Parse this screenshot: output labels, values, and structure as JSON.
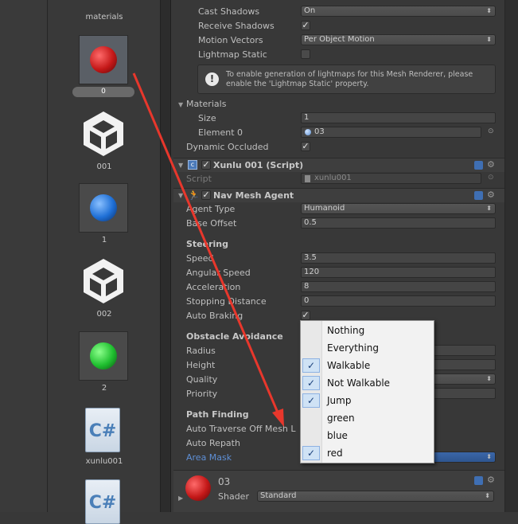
{
  "project_panel": {
    "assets": [
      {
        "name": "materials"
      },
      {
        "name": "0"
      },
      {
        "name": "001"
      },
      {
        "name": "1"
      },
      {
        "name": "002"
      },
      {
        "name": "2"
      },
      {
        "name": "xunlu001"
      }
    ],
    "cs_glyph": "C#"
  },
  "mesh_renderer": {
    "cast_shadows_label": "Cast Shadows",
    "cast_shadows_value": "On",
    "receive_shadows_label": "Receive Shadows",
    "motion_vectors_label": "Motion Vectors",
    "motion_vectors_value": "Per Object Motion",
    "lightmap_static_label": "Lightmap Static",
    "info_text": "To enable generation of lightmaps for this Mesh Renderer, please enable the 'Lightmap Static' property.",
    "materials_label": "Materials",
    "size_label": "Size",
    "size_value": "1",
    "element0_label": "Element 0",
    "element0_value": "03",
    "dynamic_occluded_label": "Dynamic Occluded"
  },
  "script_component": {
    "title": "Xunlu 001 (Script)",
    "script_label": "Script",
    "script_value": "xunlu001"
  },
  "nav_mesh_agent": {
    "title": "Nav Mesh Agent",
    "agent_type_label": "Agent Type",
    "agent_type_value": "Humanoid",
    "base_offset_label": "Base Offset",
    "base_offset_value": "0.5",
    "steering_header": "Steering",
    "speed_label": "Speed",
    "speed_value": "3.5",
    "angular_speed_label": "Angular Speed",
    "angular_speed_value": "120",
    "acceleration_label": "Acceleration",
    "acceleration_value": "8",
    "stopping_distance_label": "Stopping Distance",
    "stopping_distance_value": "0",
    "auto_braking_label": "Auto Braking",
    "obstacle_header": "Obstacle Avoidance",
    "radius_label": "Radius",
    "height_label": "Height",
    "quality_label": "Quality",
    "priority_label": "Priority",
    "pathfinding_header": "Path Finding",
    "auto_traverse_label": "Auto Traverse Off Mesh L",
    "auto_repath_label": "Auto Repath",
    "area_mask_label": "Area Mask"
  },
  "material_footer": {
    "name": "03",
    "shader_label": "Shader",
    "shader_value": "Standard"
  },
  "area_mask_menu": {
    "items": [
      {
        "label": "Nothing",
        "checked": false
      },
      {
        "label": "Everything",
        "checked": false
      },
      {
        "label": "Walkable",
        "checked": true
      },
      {
        "label": "Not Walkable",
        "checked": true
      },
      {
        "label": "Jump",
        "checked": true
      },
      {
        "label": "green",
        "checked": false
      },
      {
        "label": "blue",
        "checked": false
      },
      {
        "label": "red",
        "checked": true
      }
    ],
    "check_glyph": "✓"
  },
  "colors": {
    "annotation_arrow": "#e8372c",
    "link_label": "#5e8fd6",
    "menu_check_bg": "#cfe2f5"
  },
  "icons": [
    "unity-logo-icon",
    "csharp-file-icon",
    "sphere-material-icon",
    "gear-icon",
    "help-book-icon",
    "foldout-arrow-icon",
    "checkbox-icon",
    "info-icon"
  ]
}
